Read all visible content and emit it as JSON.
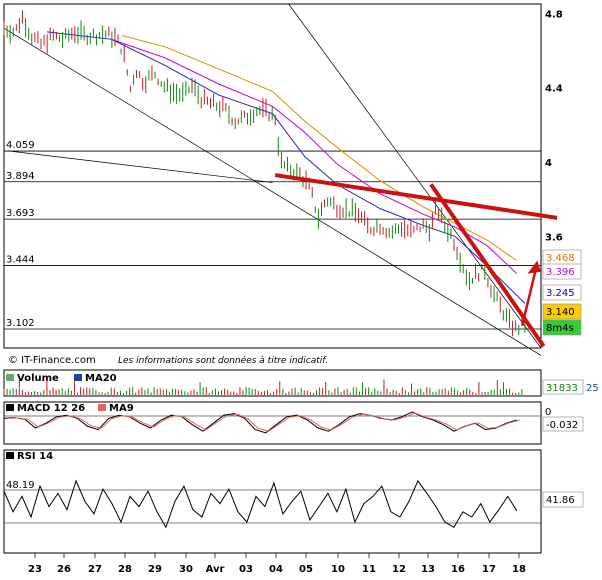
{
  "chart_data": {
    "type": "line",
    "subtype": "candlestick",
    "x_labels": [
      "23",
      "26",
      "27",
      "28",
      "29",
      "30",
      "Avr",
      "03",
      "04",
      "05",
      "10",
      "11",
      "12",
      "13",
      "16",
      "17",
      "18"
    ],
    "price_axis": {
      "ylim": [
        3.0,
        4.85
      ],
      "ticks": [
        "4.8",
        "4.4",
        "4",
        "3.6"
      ]
    },
    "horizontal_levels": [
      {
        "label": "4.059",
        "value": 4.059
      },
      {
        "label": "3.894",
        "value": 3.894
      },
      {
        "label": "3.693",
        "value": 3.693
      },
      {
        "label": "3.444",
        "value": 3.444
      },
      {
        "label": "3.102",
        "value": 3.102
      }
    ],
    "moving_average_tags": [
      {
        "value": "3.468",
        "color": "#e07000",
        "bg": "#ffffff"
      },
      {
        "value": "3.396",
        "color": "#cc00cc",
        "bg": "#ffffff"
      },
      {
        "value": "3.245",
        "color": "#0000cc",
        "bg": "#ffffff"
      },
      {
        "value": "3.140",
        "color": "#000000",
        "bg": "#ffcc00"
      },
      {
        "value": "8m4s",
        "color": "#000000",
        "bg": "#33cc33"
      }
    ],
    "price_path": [
      [
        0,
        4.72
      ],
      [
        0.02,
        4.7
      ],
      [
        0.035,
        4.78
      ],
      [
        0.05,
        4.68
      ],
      [
        0.07,
        4.63
      ],
      [
        0.09,
        4.68
      ],
      [
        0.11,
        4.66
      ],
      [
        0.13,
        4.7
      ],
      [
        0.15,
        4.68
      ],
      [
        0.17,
        4.68
      ],
      [
        0.19,
        4.69
      ],
      [
        0.205,
        4.67
      ],
      [
        0.215,
        4.64
      ],
      [
        0.225,
        4.56
      ],
      [
        0.235,
        4.39
      ],
      [
        0.245,
        4.5
      ],
      [
        0.26,
        4.43
      ],
      [
        0.28,
        4.48
      ],
      [
        0.3,
        4.4
      ],
      [
        0.32,
        4.37
      ],
      [
        0.335,
        4.36
      ],
      [
        0.35,
        4.41
      ],
      [
        0.37,
        4.33
      ],
      [
        0.39,
        4.31
      ],
      [
        0.41,
        4.29
      ],
      [
        0.43,
        4.22
      ],
      [
        0.45,
        4.24
      ],
      [
        0.47,
        4.28
      ],
      [
        0.49,
        4.27
      ],
      [
        0.505,
        4.24
      ],
      [
        0.515,
        4.0
      ],
      [
        0.53,
        3.96
      ],
      [
        0.55,
        3.94
      ],
      [
        0.57,
        3.86
      ],
      [
        0.585,
        3.7
      ],
      [
        0.6,
        3.8
      ],
      [
        0.62,
        3.76
      ],
      [
        0.64,
        3.74
      ],
      [
        0.66,
        3.72
      ],
      [
        0.68,
        3.64
      ],
      [
        0.7,
        3.66
      ],
      [
        0.72,
        3.62
      ],
      [
        0.74,
        3.65
      ],
      [
        0.76,
        3.62
      ],
      [
        0.78,
        3.66
      ],
      [
        0.795,
        3.64
      ],
      [
        0.805,
        3.76
      ],
      [
        0.82,
        3.66
      ],
      [
        0.835,
        3.6
      ],
      [
        0.85,
        3.48
      ],
      [
        0.865,
        3.36
      ],
      [
        0.88,
        3.4
      ],
      [
        0.895,
        3.42
      ],
      [
        0.91,
        3.3
      ],
      [
        0.925,
        3.22
      ],
      [
        0.94,
        3.14
      ],
      [
        0.955,
        3.1
      ],
      [
        0.97,
        3.14
      ]
    ],
    "ma_blue": [
      [
        0.08,
        4.7
      ],
      [
        0.2,
        4.66
      ],
      [
        0.3,
        4.52
      ],
      [
        0.4,
        4.36
      ],
      [
        0.5,
        4.26
      ],
      [
        0.56,
        4.03
      ],
      [
        0.62,
        3.88
      ],
      [
        0.7,
        3.75
      ],
      [
        0.78,
        3.66
      ],
      [
        0.84,
        3.6
      ],
      [
        0.9,
        3.44
      ],
      [
        0.97,
        3.24
      ]
    ],
    "ma_magenta": [
      [
        0.2,
        4.66
      ],
      [
        0.3,
        4.56
      ],
      [
        0.4,
        4.42
      ],
      [
        0.5,
        4.3
      ],
      [
        0.56,
        4.16
      ],
      [
        0.62,
        3.99
      ],
      [
        0.7,
        3.83
      ],
      [
        0.78,
        3.72
      ],
      [
        0.84,
        3.65
      ],
      [
        0.9,
        3.55
      ],
      [
        0.955,
        3.4
      ]
    ],
    "ma_orange": [
      [
        0.22,
        4.68
      ],
      [
        0.3,
        4.62
      ],
      [
        0.4,
        4.5
      ],
      [
        0.5,
        4.38
      ],
      [
        0.56,
        4.22
      ],
      [
        0.62,
        4.08
      ],
      [
        0.7,
        3.9
      ],
      [
        0.78,
        3.76
      ],
      [
        0.84,
        3.67
      ],
      [
        0.9,
        3.58
      ],
      [
        0.955,
        3.47
      ]
    ],
    "volume": {
      "label": "Volume",
      "ma_label": "MA20",
      "value": "31833",
      "value2": "25"
    },
    "macd": {
      "label": "MACD 12 26",
      "signal_label": "MA9",
      "zero": "0",
      "value": "-0.032",
      "path": [
        0.1,
        0.15,
        0.05,
        -0.5,
        -0.2,
        0.2,
        0.3,
        0.1,
        -0.4,
        -0.6,
        0.1,
        0.3,
        0.2,
        -0.2,
        -0.5,
        0.0,
        0.3,
        0.2,
        -0.3,
        -0.7,
        -0.2,
        0.3,
        0.4,
        0.1,
        -0.6,
        -0.8,
        -0.3,
        0.2,
        0.3,
        0.0,
        -0.5,
        -0.7,
        -0.3,
        0.2,
        0.4,
        0.3,
        0.1,
        0.0,
        0.2,
        0.5,
        0.2,
        0.0,
        -0.3,
        -0.7,
        -0.4,
        -0.2,
        -0.6,
        -0.5,
        -0.2,
        0.0
      ]
    },
    "rsi": {
      "label": "RSI 14",
      "level_label": "48.19",
      "value": "41.86",
      "path": [
        60,
        40,
        55,
        35,
        65,
        45,
        58,
        42,
        70,
        50,
        38,
        62,
        48,
        30,
        55,
        45,
        60,
        40,
        25,
        50,
        65,
        42,
        35,
        58,
        48,
        62,
        40,
        30,
        55,
        45,
        68,
        38,
        50,
        60,
        32,
        45,
        58,
        40,
        62,
        30,
        48,
        55,
        65,
        40,
        35,
        50,
        70,
        58,
        45,
        30,
        25,
        40,
        35,
        48,
        30,
        42,
        55,
        41
      ]
    },
    "copyright": "© IT-Finance.com",
    "disclaimer": "Les informations sont données à titre indicatif."
  }
}
